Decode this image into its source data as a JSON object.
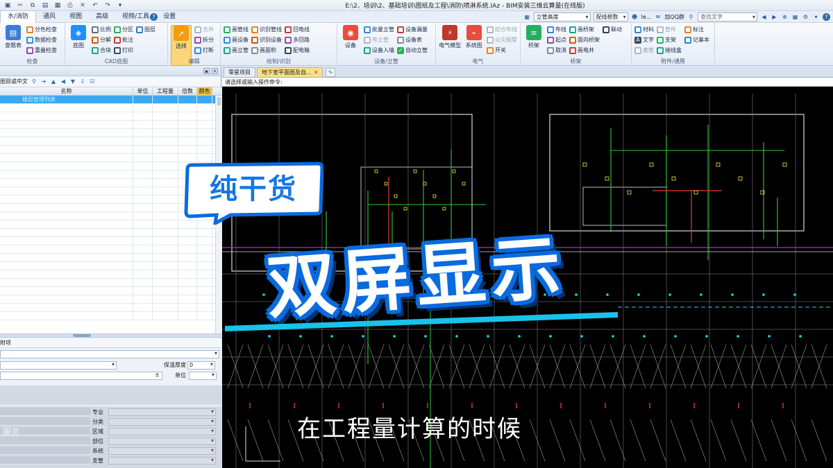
{
  "window": {
    "title": "E:\\2、培训\\2、基础培训\\图纸及工程\\消防\\喷淋系统.IAz - BIM安装三维云算量(在线版)"
  },
  "menu": {
    "tabs": [
      "水/消防",
      "通风",
      "视图",
      "高级",
      "视频/工具",
      "设置"
    ],
    "right": {
      "pipe_height": "立管高度",
      "wire_roots": "配线根数",
      "user": "le...",
      "qq_group": "加QQ群",
      "search_placeholder": "查找文字"
    }
  },
  "ribbon": {
    "groups": [
      {
        "label": "检查",
        "big": "查题表",
        "items": [
          "分色检查",
          "数据检查",
          "重叠检查"
        ]
      },
      {
        "label": "CAD底图",
        "big": "底图",
        "items": [
          "比例",
          "分区",
          "图层",
          "分解",
          "批注",
          "合块",
          "打印"
        ]
      },
      {
        "label": "编辑",
        "big": "选择",
        "items": [
          "合并",
          "拆分",
          "打断"
        ]
      },
      {
        "label": "绘制/识别",
        "items": [
          "画管线",
          "识别管线",
          "回电线",
          "画设备",
          "识别设备",
          "多回路",
          "画立管",
          "画面积",
          "配电箱"
        ]
      },
      {
        "label": "设备/立管",
        "big": "设备",
        "items": [
          "批量立管",
          "设备漏量",
          "布立管",
          "设备表",
          "设备入墙",
          "自动立管"
        ]
      },
      {
        "label": "电气",
        "items": [
          "电气模型",
          "系统图",
          "综合布线",
          "火灾报警",
          "开关"
        ]
      },
      {
        "label": "桥架",
        "big": "桥架",
        "items": [
          "布线",
          "画桥架",
          "联动",
          "起点",
          "面向桥架",
          "取消",
          "画电井"
        ]
      },
      {
        "label": "附件/通用",
        "items": [
          "材料",
          "管件",
          "标注",
          "文字",
          "支架",
          "记事本",
          "套管",
          "接线盒"
        ]
      }
    ]
  },
  "left_panel": {
    "search_label": "图目或中文",
    "columns": [
      "名称",
      "单位",
      "工程量",
      "倍数",
      "颜色"
    ],
    "selected_row_text": "楼层管理列表",
    "props_title": "附项",
    "insulation_label": "保温厚度",
    "insulation_value": "0",
    "unit_label": "单位",
    "attributes": [
      "专业",
      "分类",
      "区域",
      "部位",
      "系统",
      "支管"
    ],
    "watermark": "服务"
  },
  "doc": {
    "tabs": [
      "零星项目",
      "地下室平面图及自..."
    ],
    "command_prompt": "请选择或输入操作命令:"
  },
  "overlay": {
    "badge": "纯干货",
    "headline": "双屏显示",
    "subtitle": "在工程量计算的时候"
  },
  "colors": {
    "accent": "#0a6be0",
    "canvas_bg": "#000000",
    "selection": "#38a9f2"
  }
}
